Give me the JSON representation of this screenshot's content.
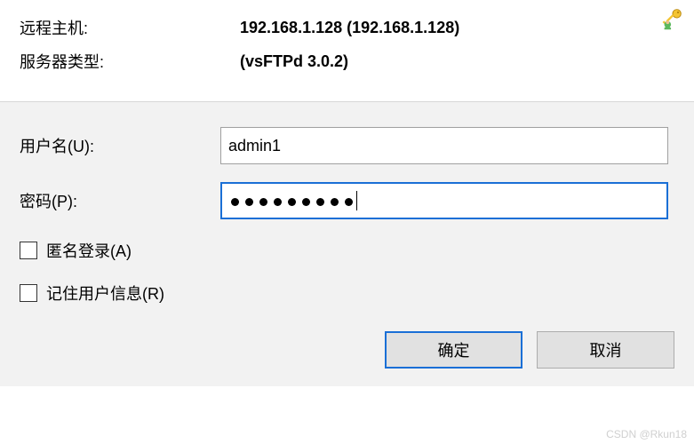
{
  "header": {
    "remote_host_label": "远程主机:",
    "remote_host_value": "192.168.1.128 (192.168.1.128)",
    "server_type_label": "服务器类型:",
    "server_type_value": "(vsFTPd 3.0.2)"
  },
  "form": {
    "username_label": "用户名(U):",
    "username_value": "admin1",
    "password_label": "密码(P):",
    "password_dot_count": 9,
    "anonymous_label": "匿名登录(A)",
    "anonymous_checked": false,
    "remember_label": "记住用户信息(R)",
    "remember_checked": false
  },
  "buttons": {
    "ok_label": "确定",
    "cancel_label": "取消"
  },
  "watermark": "CSDN @Rkun18",
  "colors": {
    "focus_border": "#1a6fd6",
    "form_bg": "#f2f2f2",
    "btn_bg": "#e1e1e1"
  }
}
